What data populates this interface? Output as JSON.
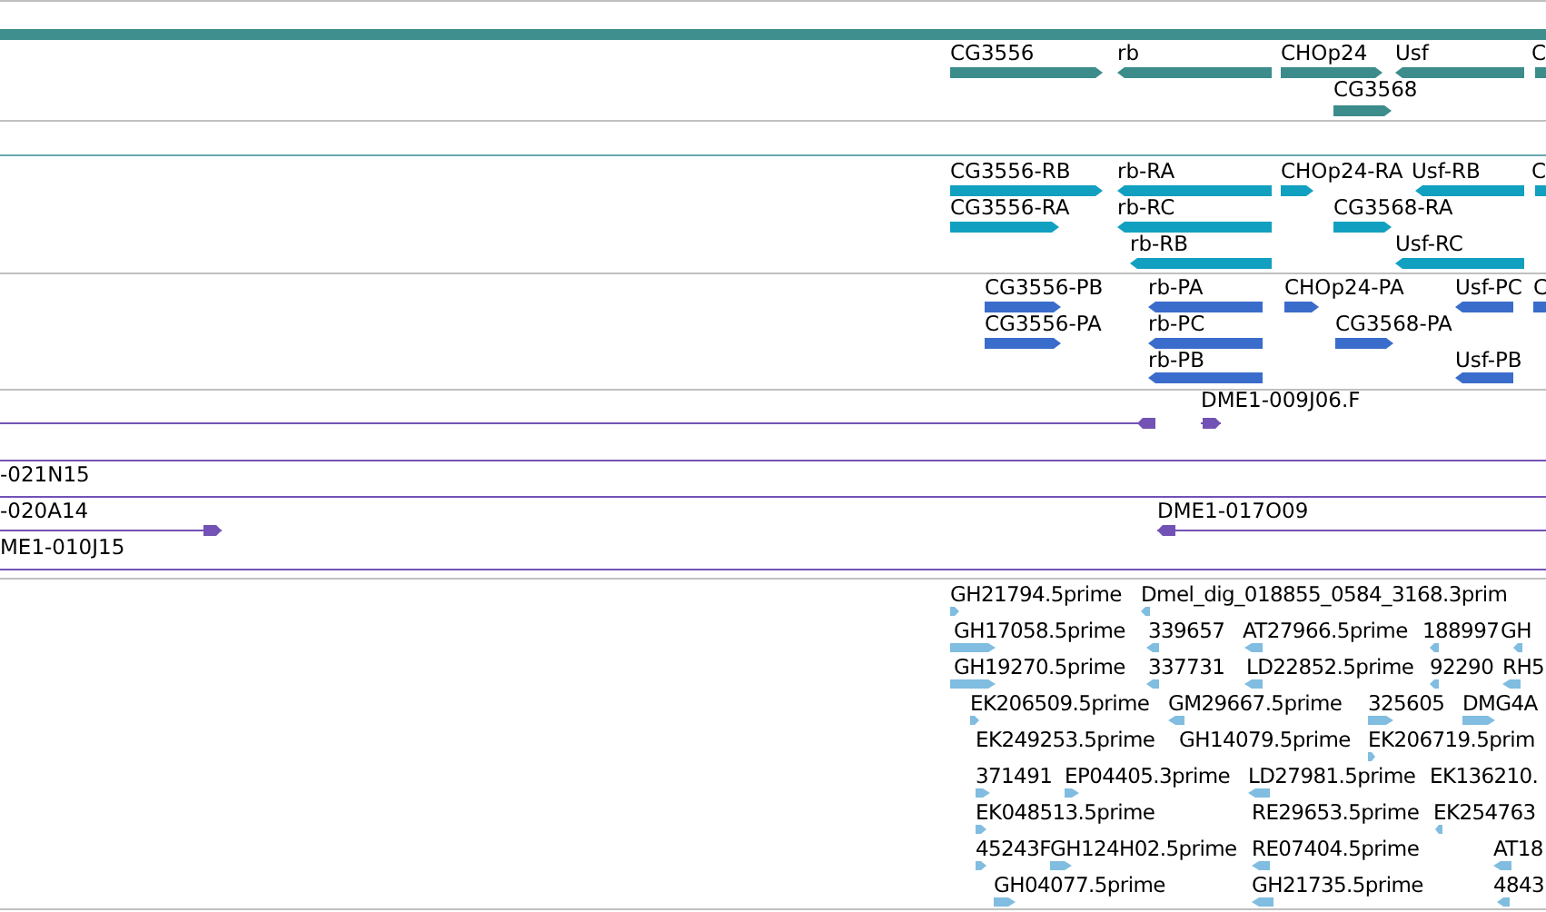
{
  "tracks": [
    {
      "kind": "gene",
      "features": [
        {
          "label": "CG3556",
          "reverse": false
        },
        {
          "label": "rb",
          "reverse": true
        },
        {
          "label": "CHOp24",
          "reverse": false
        },
        {
          "label": "Usf",
          "reverse": true
        },
        {
          "label": "C"
        },
        {
          "label": "CG3568",
          "reverse": false
        }
      ]
    },
    {
      "kind": "transcript",
      "features": [
        {
          "label": "CG3556-RB",
          "reverse": false
        },
        {
          "label": "rb-RA",
          "reverse": true
        },
        {
          "label": "CHOp24-RA",
          "reverse": false
        },
        {
          "label": "Usf-RB",
          "reverse": true
        },
        {
          "label": "C"
        },
        {
          "label": "CG3556-RA",
          "reverse": false
        },
        {
          "label": "rb-RC",
          "reverse": true
        },
        {
          "label": "CG3568-RA",
          "reverse": false
        },
        {
          "label": "rb-RB",
          "reverse": true
        },
        {
          "label": "Usf-RC",
          "reverse": true
        }
      ]
    },
    {
      "kind": "protein",
      "features": [
        {
          "label": "CG3556-PB",
          "reverse": false
        },
        {
          "label": "rb-PA",
          "reverse": true
        },
        {
          "label": "CHOp24-PA",
          "reverse": false
        },
        {
          "label": "Usf-PC",
          "reverse": true
        },
        {
          "label": "C"
        },
        {
          "label": "CG3556-PA",
          "reverse": false
        },
        {
          "label": "rb-PC",
          "reverse": true
        },
        {
          "label": "CG3568-PA",
          "reverse": false
        },
        {
          "label": "rb-PB",
          "reverse": true
        },
        {
          "label": "Usf-PB",
          "reverse": true
        }
      ]
    },
    {
      "kind": "clone",
      "features": [
        {
          "reverse": true
        },
        {
          "label": "DME1-009J06.F",
          "reverse": false
        },
        {
          "label": "-021N15"
        },
        {
          "label": "-020A14",
          "reverse": false
        },
        {
          "label": "ME1-010J15"
        },
        {
          "label": "DME1-017O09",
          "reverse": true
        }
      ]
    },
    {
      "kind": "est",
      "features": [
        {
          "label": "GH21794.5prime",
          "reverse": false
        },
        {
          "label": "Dmel_dig_018855_0584_3168.3prim",
          "reverse": true
        },
        {
          "label": "GH17058.5prime",
          "reverse": false
        },
        {
          "label": "339657",
          "reverse": true
        },
        {
          "label": "AT27966.5prime",
          "reverse": true
        },
        {
          "label": "188997",
          "reverse": true
        },
        {
          "label": "GH",
          "reverse": true
        },
        {
          "label": "GH19270.5prime",
          "reverse": false
        },
        {
          "label": "337731",
          "reverse": true
        },
        {
          "label": "LD22852.5prime",
          "reverse": true
        },
        {
          "label": "92290",
          "reverse": true
        },
        {
          "label": "RH5",
          "reverse": true
        },
        {
          "label": "EK206509.5prime",
          "reverse": false
        },
        {
          "label": "GM29667.5prime",
          "reverse": true
        },
        {
          "label": "325605",
          "reverse": false
        },
        {
          "label": "DMG4A",
          "reverse": false
        },
        {
          "label": "EK249253.5prime"
        },
        {
          "label": "GH14079.5prime"
        },
        {
          "label": "EK206719.5prim",
          "reverse": false
        },
        {
          "label": "371491",
          "reverse": false
        },
        {
          "label": "EP04405.3prime",
          "reverse": false
        },
        {
          "label": "LD27981.5prime",
          "reverse": true
        },
        {
          "label": "EK136210."
        },
        {
          "label": "EK048513.5prime",
          "reverse": false
        },
        {
          "label": "RE29653.5prime"
        },
        {
          "label": "EK254763",
          "reverse": true
        },
        {
          "label": "45243F",
          "reverse": false
        },
        {
          "label": "GH124H02.5prime",
          "reverse": false
        },
        {
          "label": "RE07404.5prime",
          "reverse": true
        },
        {
          "label": "AT18",
          "reverse": true
        },
        {
          "label": "GH04077.5prime",
          "reverse": false
        },
        {
          "label": "GH21735.5prime",
          "reverse": true
        },
        {
          "label": "4843",
          "reverse": true
        }
      ]
    }
  ]
}
